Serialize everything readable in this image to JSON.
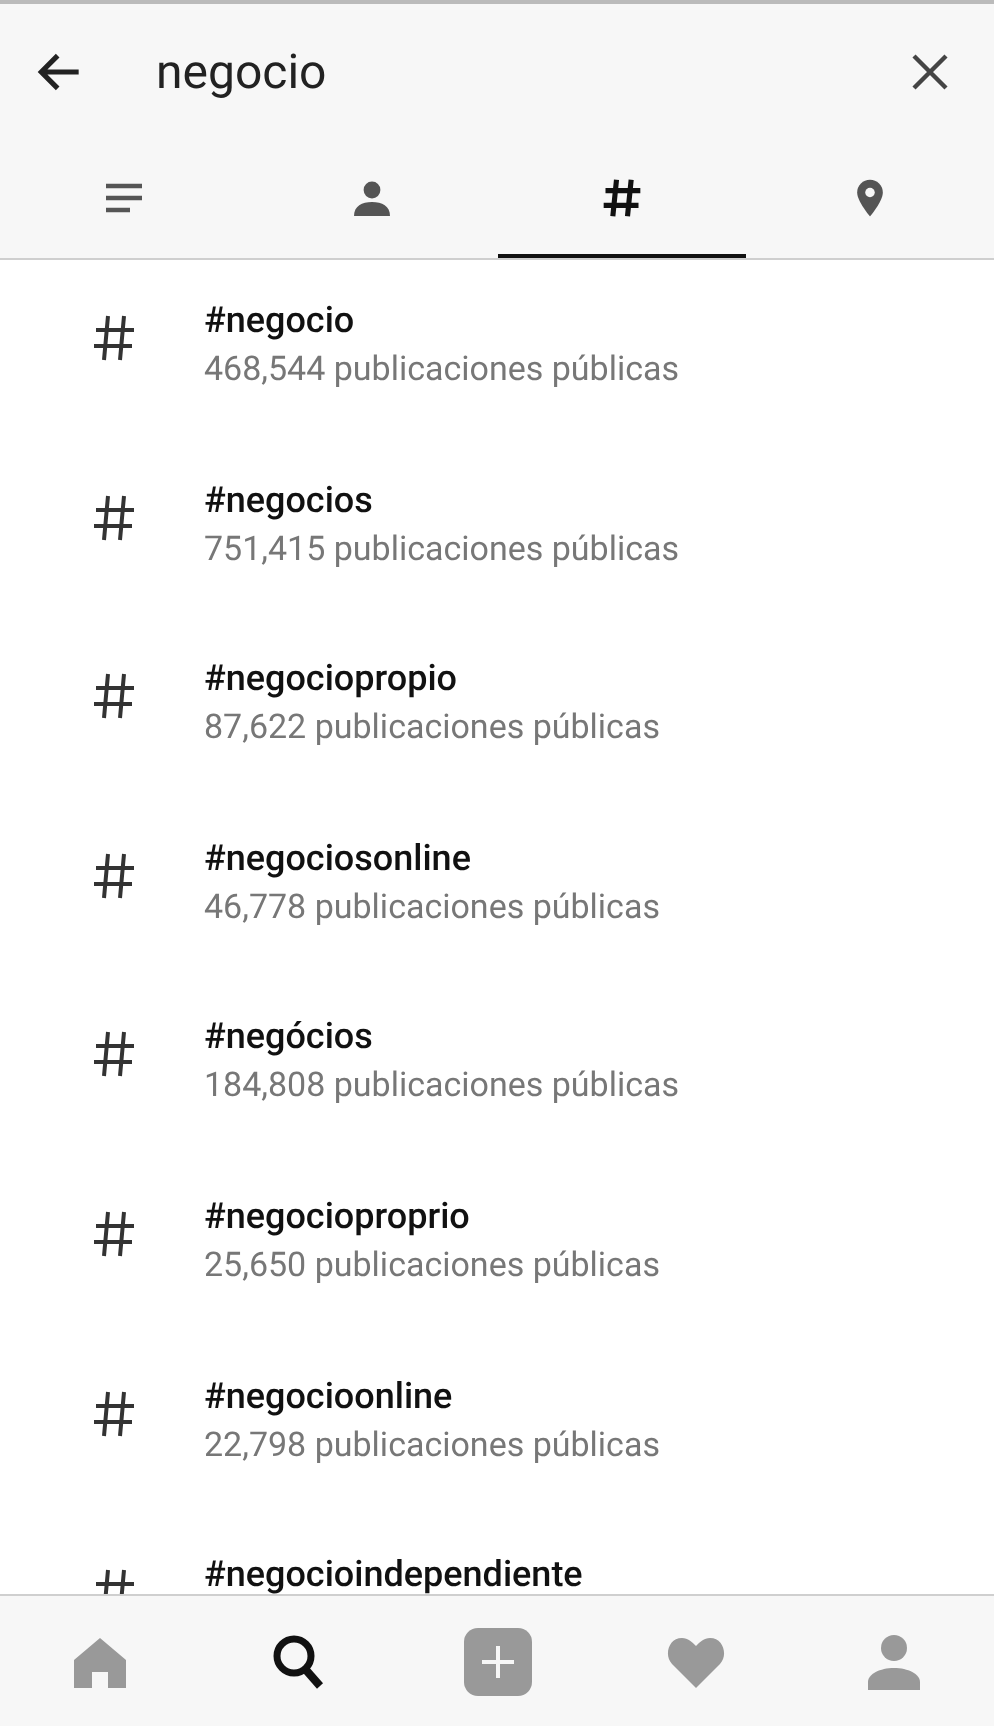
{
  "search": {
    "value": "negocio"
  },
  "tabs": [
    {
      "kind": "top",
      "selected": false
    },
    {
      "kind": "people",
      "selected": false
    },
    {
      "kind": "tags",
      "selected": true
    },
    {
      "kind": "places",
      "selected": false
    }
  ],
  "results": [
    {
      "tag": "#negocio",
      "count": "468,544 publicaciones públicas"
    },
    {
      "tag": "#negocios",
      "count": "751,415 publicaciones públicas"
    },
    {
      "tag": "#negociopropio",
      "count": "87,622 publicaciones públicas"
    },
    {
      "tag": "#negociosonline",
      "count": "46,778 publicaciones públicas"
    },
    {
      "tag": "#negócios",
      "count": "184,808 publicaciones públicas"
    },
    {
      "tag": "#negocioproprio",
      "count": "25,650 publicaciones públicas"
    },
    {
      "tag": "#negocioonline",
      "count": "22,798 publicaciones públicas"
    },
    {
      "tag": "#negocioindependiente"
    }
  ],
  "nav": [
    {
      "kind": "home",
      "selected": false
    },
    {
      "kind": "search",
      "selected": true
    },
    {
      "kind": "add",
      "selected": false
    },
    {
      "kind": "heart",
      "selected": false
    },
    {
      "kind": "profile",
      "selected": false
    }
  ]
}
